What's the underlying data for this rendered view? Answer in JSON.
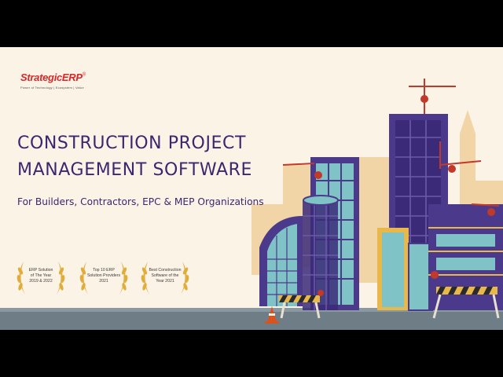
{
  "brand": {
    "name": "StrategicERP",
    "registered": "®",
    "tagline": "Power of Technology | Ecosystem | Value"
  },
  "hero": {
    "title_line1": "CONSTRUCTION PROJECT",
    "title_line2": "MANAGEMENT SOFTWARE",
    "subtitle": "For Builders, Contractors, EPC & MEP Organizations"
  },
  "awards": [
    {
      "line1": "ERP Solution",
      "line2": "of The Year",
      "line3": "2019 & 2022"
    },
    {
      "line1": "Top 10 ERP",
      "line2": "Solution Providers",
      "line3": "2021"
    },
    {
      "line1": "Best Construction",
      "line2": "Software of the",
      "line3": "Year 2021"
    }
  ],
  "colors": {
    "title": "#3d2670",
    "brand_red": "#d62828",
    "background": "#fbf3e6",
    "laurel_gold": "#e0ad3a",
    "building_purple": "#4b3a8c",
    "glass_teal": "#7fc3c7",
    "crane_red": "#c0392b"
  },
  "icons": [
    "laurel-wreath-icon",
    "building-illustration",
    "crane-illustration",
    "barricade-illustration",
    "traffic-cone-icon"
  ]
}
